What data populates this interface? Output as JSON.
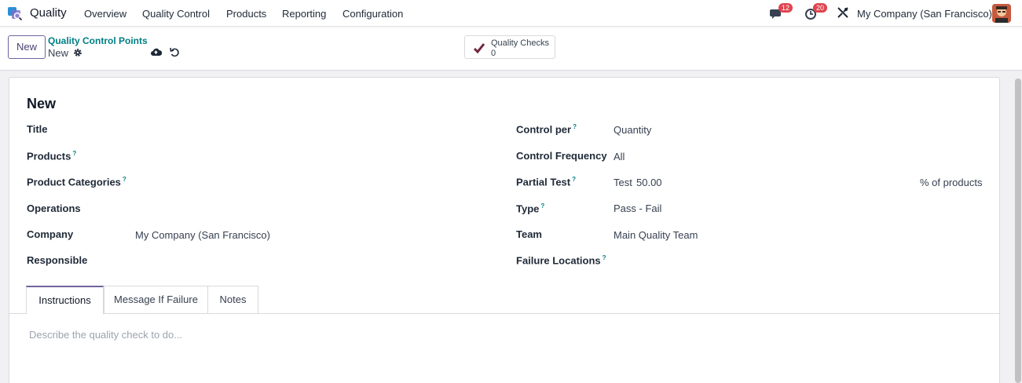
{
  "navbar": {
    "app_name": "Quality",
    "menu": [
      "Overview",
      "Quality Control",
      "Products",
      "Reporting",
      "Configuration"
    ],
    "messages_count": "12",
    "activities_count": "20",
    "company": "My Company (San Francisco)"
  },
  "control_panel": {
    "new_button": "New",
    "breadcrumb": "Quality Control Points",
    "record_name": "New",
    "smart_button": {
      "label": "Quality Checks",
      "count": "0"
    }
  },
  "form": {
    "title": "New",
    "left_fields": [
      {
        "label": "Title",
        "value": ""
      },
      {
        "label": "Products",
        "help": "?",
        "value": ""
      },
      {
        "label": "Product Categories",
        "help": "?",
        "value": ""
      },
      {
        "label": "Operations",
        "value": ""
      },
      {
        "label": "Company",
        "value": "My Company (San Francisco)"
      },
      {
        "label": "Responsible",
        "value": ""
      }
    ],
    "right_fields": [
      {
        "label": "Control per",
        "help": "?",
        "value": "Quantity"
      },
      {
        "label": "Control Frequency",
        "value": "All"
      },
      {
        "label": "Partial Test",
        "help": "?",
        "value": "Test",
        "number": "50.00",
        "suffix": "% of products"
      },
      {
        "label": "Type",
        "help": "?",
        "value": "Pass - Fail"
      },
      {
        "label": "Team",
        "value": "Main Quality Team"
      },
      {
        "label": "Failure Locations",
        "help": "?",
        "value": ""
      }
    ],
    "tabs": [
      "Instructions",
      "Message If Failure",
      "Notes"
    ],
    "instructions_placeholder": "Describe the quality check to do..."
  },
  "colors": {
    "accent": "#71639e",
    "link": "#017e84",
    "badge": "#e0444e"
  }
}
